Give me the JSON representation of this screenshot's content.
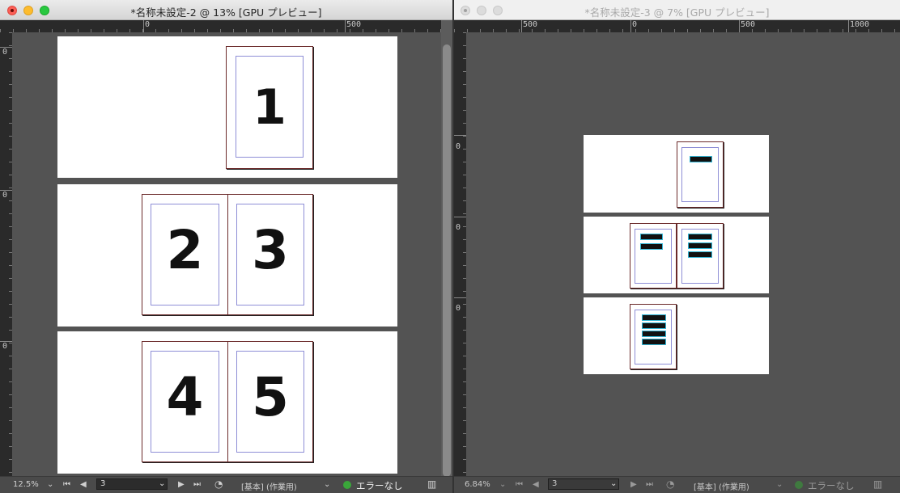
{
  "windows": [
    {
      "title": "*名称未設定-2 @ 13% [GPU プレビュー]",
      "ruler_labels": [
        "0",
        "500"
      ],
      "vruler_labels": [
        "0",
        "0",
        "0"
      ],
      "status": {
        "zoom": "12.5%",
        "page": "3",
        "profile": "[基本] (作業用)",
        "preflight": "エラーなし"
      },
      "page_numbers": [
        "1",
        "2",
        "3",
        "4",
        "5"
      ]
    },
    {
      "title": "*名称未設定-3 @ 7% [GPU プレビュー]",
      "ruler_labels": [
        "500",
        "0",
        "500",
        "1000"
      ],
      "vruler_labels": [
        "0",
        "0",
        "0"
      ],
      "status": {
        "zoom": "6.84%",
        "page": "3",
        "profile": "[基本] (作業用)",
        "preflight": "エラーなし"
      }
    }
  ],
  "colors": {
    "pasteboard": "#535353",
    "ok": "#3aa63a",
    "margin_guide": "#8e8ed6",
    "page_border": "#6b2a2a"
  },
  "icons": [
    "chevron-down-icon",
    "first-page-icon",
    "prev-page-icon",
    "next-page-icon",
    "last-page-icon",
    "spread-toggle-icon"
  ]
}
